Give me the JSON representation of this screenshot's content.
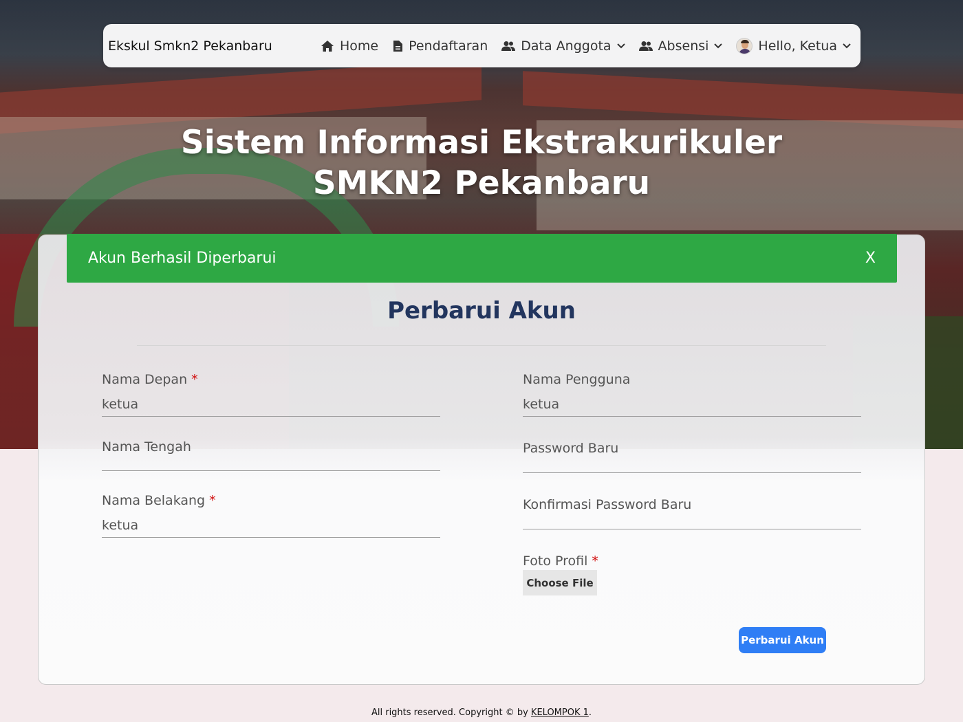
{
  "navbar": {
    "brand": "Ekskul Smkn2 Pekanbaru",
    "items": [
      {
        "label": "Home",
        "icon": "home-icon"
      },
      {
        "label": "Pendaftaran",
        "icon": "document-icon"
      },
      {
        "label": "Data Anggota",
        "icon": "users-icon"
      },
      {
        "label": "Absensi",
        "icon": "users-icon"
      },
      {
        "label": "Hello, Ketua",
        "icon": "avatar"
      }
    ]
  },
  "hero": {
    "title_line1": "Sistem Informasi Ekstrakurikuler",
    "title_line2": "SMKN2 Pekanbaru"
  },
  "alert": {
    "message": "Akun Berhasil Diperbarui",
    "close_label": "X",
    "color": "#2ea844"
  },
  "form": {
    "title": "Perbarui Akun",
    "nama_depan": {
      "label": "Nama Depan",
      "required": "*",
      "value": "ketua"
    },
    "nama_tengah": {
      "label": "Nama Tengah",
      "value": ""
    },
    "nama_belakang": {
      "label": "Nama Belakang",
      "required": "*",
      "value": "ketua"
    },
    "nama_pengguna": {
      "label": "Nama Pengguna",
      "value": "ketua"
    },
    "password_baru": {
      "label": "Password Baru",
      "value": ""
    },
    "konfirmasi_password": {
      "label": "Konfirmasi Password Baru",
      "value": ""
    },
    "foto_profil": {
      "label": "Foto Profil",
      "required": "*",
      "button": "Choose File"
    },
    "submit_label": "Perbarui Akun",
    "submit_color": "#2f7ef5"
  },
  "footer": {
    "text": "All rights reserved. Copyright © by",
    "link": "KELOMPOK 1",
    "suffix": "."
  }
}
